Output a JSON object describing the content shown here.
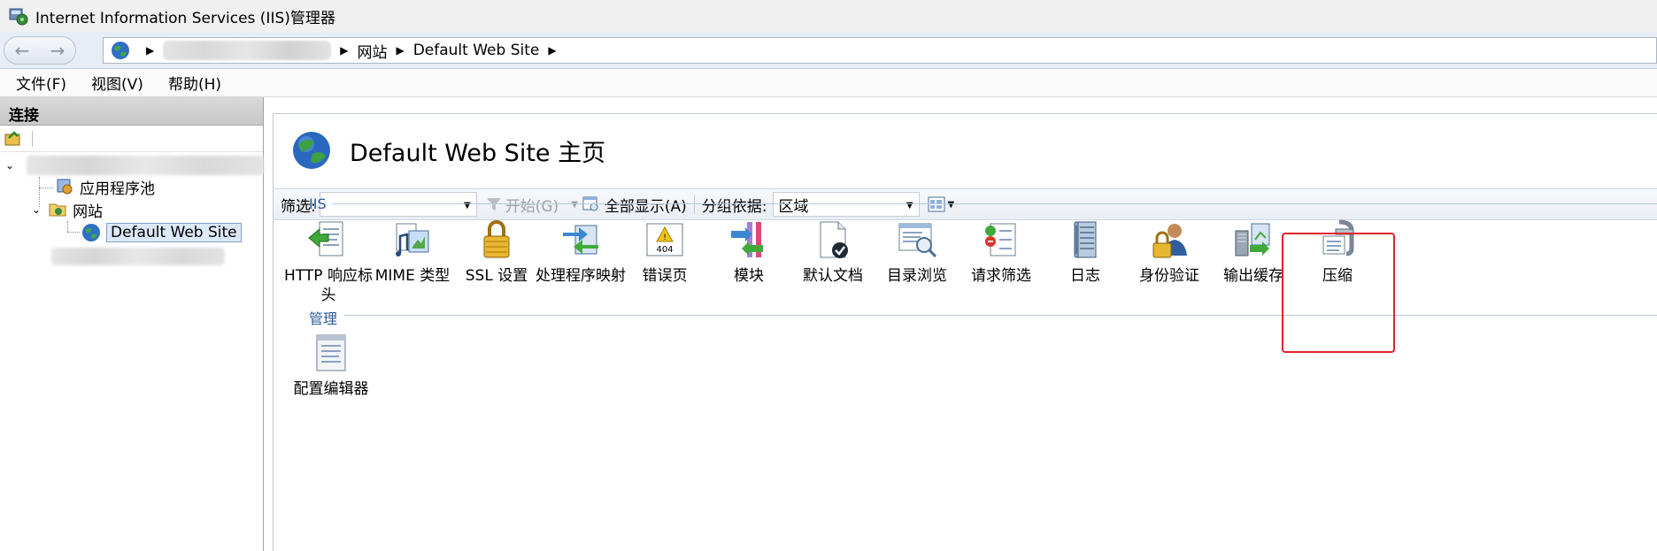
{
  "window": {
    "title": "Internet Information Services (IIS)管理器"
  },
  "address": {
    "crumbs": [
      "网站",
      "Default Web Site"
    ]
  },
  "menu": {
    "items": [
      "文件(F)",
      "视图(V)",
      "帮助(H)"
    ]
  },
  "connections": {
    "header": "连接",
    "tree": {
      "app_pools": "应用程序池",
      "sites": "网站",
      "default_site": "Default Web Site"
    }
  },
  "main": {
    "title": "Default Web Site 主页",
    "filter": {
      "label": "筛选:",
      "start": "开始(G)",
      "show_all": "全部显示(A)",
      "group_label": "分组依据:",
      "group_value": "区域"
    },
    "groups": {
      "iis": {
        "label": "IIS",
        "features": [
          {
            "label": "HTTP 响应标头",
            "icon": "http-headers-icon"
          },
          {
            "label": "MIME 类型",
            "icon": "mime-types-icon"
          },
          {
            "label": "SSL 设置",
            "icon": "ssl-lock-icon"
          },
          {
            "label": "处理程序映射",
            "icon": "handler-mappings-icon"
          },
          {
            "label": "错误页",
            "icon": "error-page-404-icon"
          },
          {
            "label": "模块",
            "icon": "modules-icon"
          },
          {
            "label": "默认文档",
            "icon": "default-document-icon"
          },
          {
            "label": "目录浏览",
            "icon": "directory-browsing-icon"
          },
          {
            "label": "请求筛选",
            "icon": "request-filtering-icon"
          },
          {
            "label": "日志",
            "icon": "logging-icon"
          },
          {
            "label": "身份验证",
            "icon": "authentication-icon"
          },
          {
            "label": "输出缓存",
            "icon": "output-caching-icon"
          },
          {
            "label": "压缩",
            "icon": "compression-icon"
          }
        ]
      },
      "management": {
        "label": "管理",
        "features": [
          {
            "label": "配置编辑器",
            "icon": "configuration-editor-icon"
          }
        ]
      }
    }
  },
  "colors": {
    "highlight": "#e0242b",
    "group_text": "#2a5a9a"
  }
}
